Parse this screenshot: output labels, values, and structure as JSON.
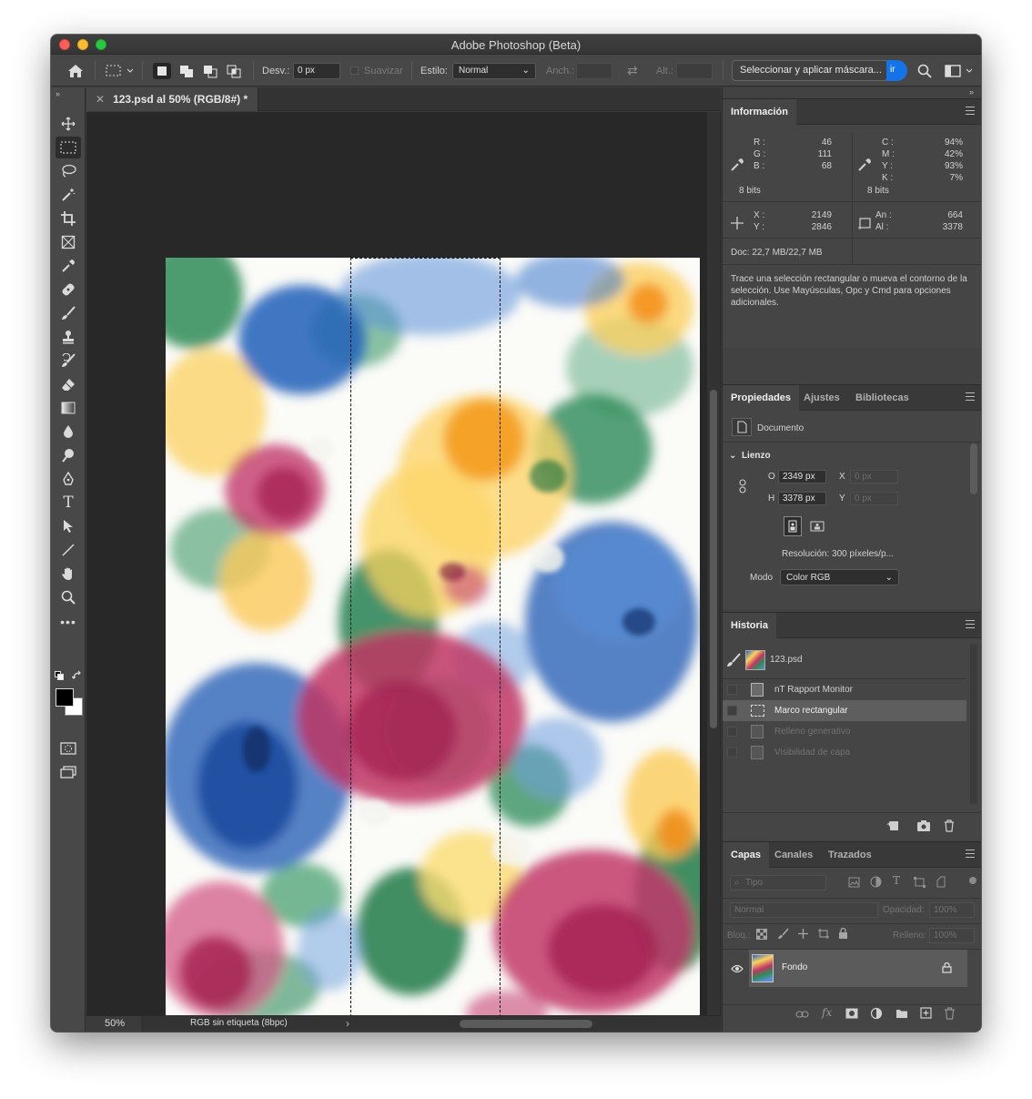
{
  "window": {
    "title": "Adobe Photoshop (Beta)"
  },
  "options": {
    "desv_label": "Desv.:",
    "desv_value": "0 px",
    "suavizar": "Suavizar",
    "estilo_label": "Estilo:",
    "estilo_value": "Normal",
    "anch_label": "Anch.:",
    "alt_label": "Alt.:",
    "select_mask_button": "Seleccionar y aplicar máscara...",
    "blue_button": "ir"
  },
  "document": {
    "tab_title": "123.psd al 50% (RGB/8#) *",
    "zoom": "50%",
    "color_profile": "RGB sin etiqueta (8bpc)"
  },
  "info_panel": {
    "tab": "Información",
    "rgb": [
      {
        "k": "R :",
        "v": "46"
      },
      {
        "k": "G :",
        "v": "111"
      },
      {
        "k": "B :",
        "v": "68"
      }
    ],
    "cmyk": [
      {
        "k": "C :",
        "v": "94%"
      },
      {
        "k": "M :",
        "v": "42%"
      },
      {
        "k": "Y :",
        "v": "93%"
      },
      {
        "k": "K :",
        "v": "7%"
      }
    ],
    "bits_left": "8 bits",
    "bits_right": "8 bits",
    "xy": [
      {
        "k": "X :",
        "v": "2149"
      },
      {
        "k": "Y :",
        "v": "2846"
      }
    ],
    "size": [
      {
        "k": "An :",
        "v": "664"
      },
      {
        "k": "Al :",
        "v": "3378"
      }
    ],
    "doc": "Doc: 22,7 MB/22,7 MB",
    "hint": "Trace una selección rectangular o mueva el contorno de la selección. Use Mayúsculas, Opc y Cmd para opciones adicionales."
  },
  "properties_panel": {
    "tabs": [
      "Propiedades",
      "Ajustes",
      "Bibliotecas"
    ],
    "doc_label": "Documento",
    "section": "Lienzo",
    "w_label": "O",
    "w_value": "2349 px",
    "h_label": "H",
    "h_value": "3378 px",
    "x_label": "X",
    "x_value": "0 px",
    "y_label": "Y",
    "y_value": "0 px",
    "resolution": "Resolución: 300 píxeles/p...",
    "mode_label": "Modo",
    "mode_value": "Color RGB"
  },
  "history_panel": {
    "tab": "Historia",
    "snapshot": "123.psd",
    "items": [
      {
        "label": "nT Rapport Monitor",
        "state": "normal"
      },
      {
        "label": "Marco rectangular",
        "state": "selected"
      },
      {
        "label": "Relleno generativo",
        "state": "dimmed"
      },
      {
        "label": "Visibilidad de capa",
        "state": "dimmed"
      }
    ]
  },
  "layers_panel": {
    "tabs": [
      "Capas",
      "Canales",
      "Trazados"
    ],
    "filter_placeholder": "Tipo",
    "blend_mode": "Normal",
    "opacity_label": "Opacidad:",
    "opacity_value": "100%",
    "lock_label": "Bloq.:",
    "fill_label": "Relleno:",
    "fill_value": "100%",
    "layer_name": "Fondo"
  },
  "colors": {
    "accent_blue": "#1473e6",
    "panel_bg": "#454545",
    "history_selected": "#5e5e5e"
  }
}
